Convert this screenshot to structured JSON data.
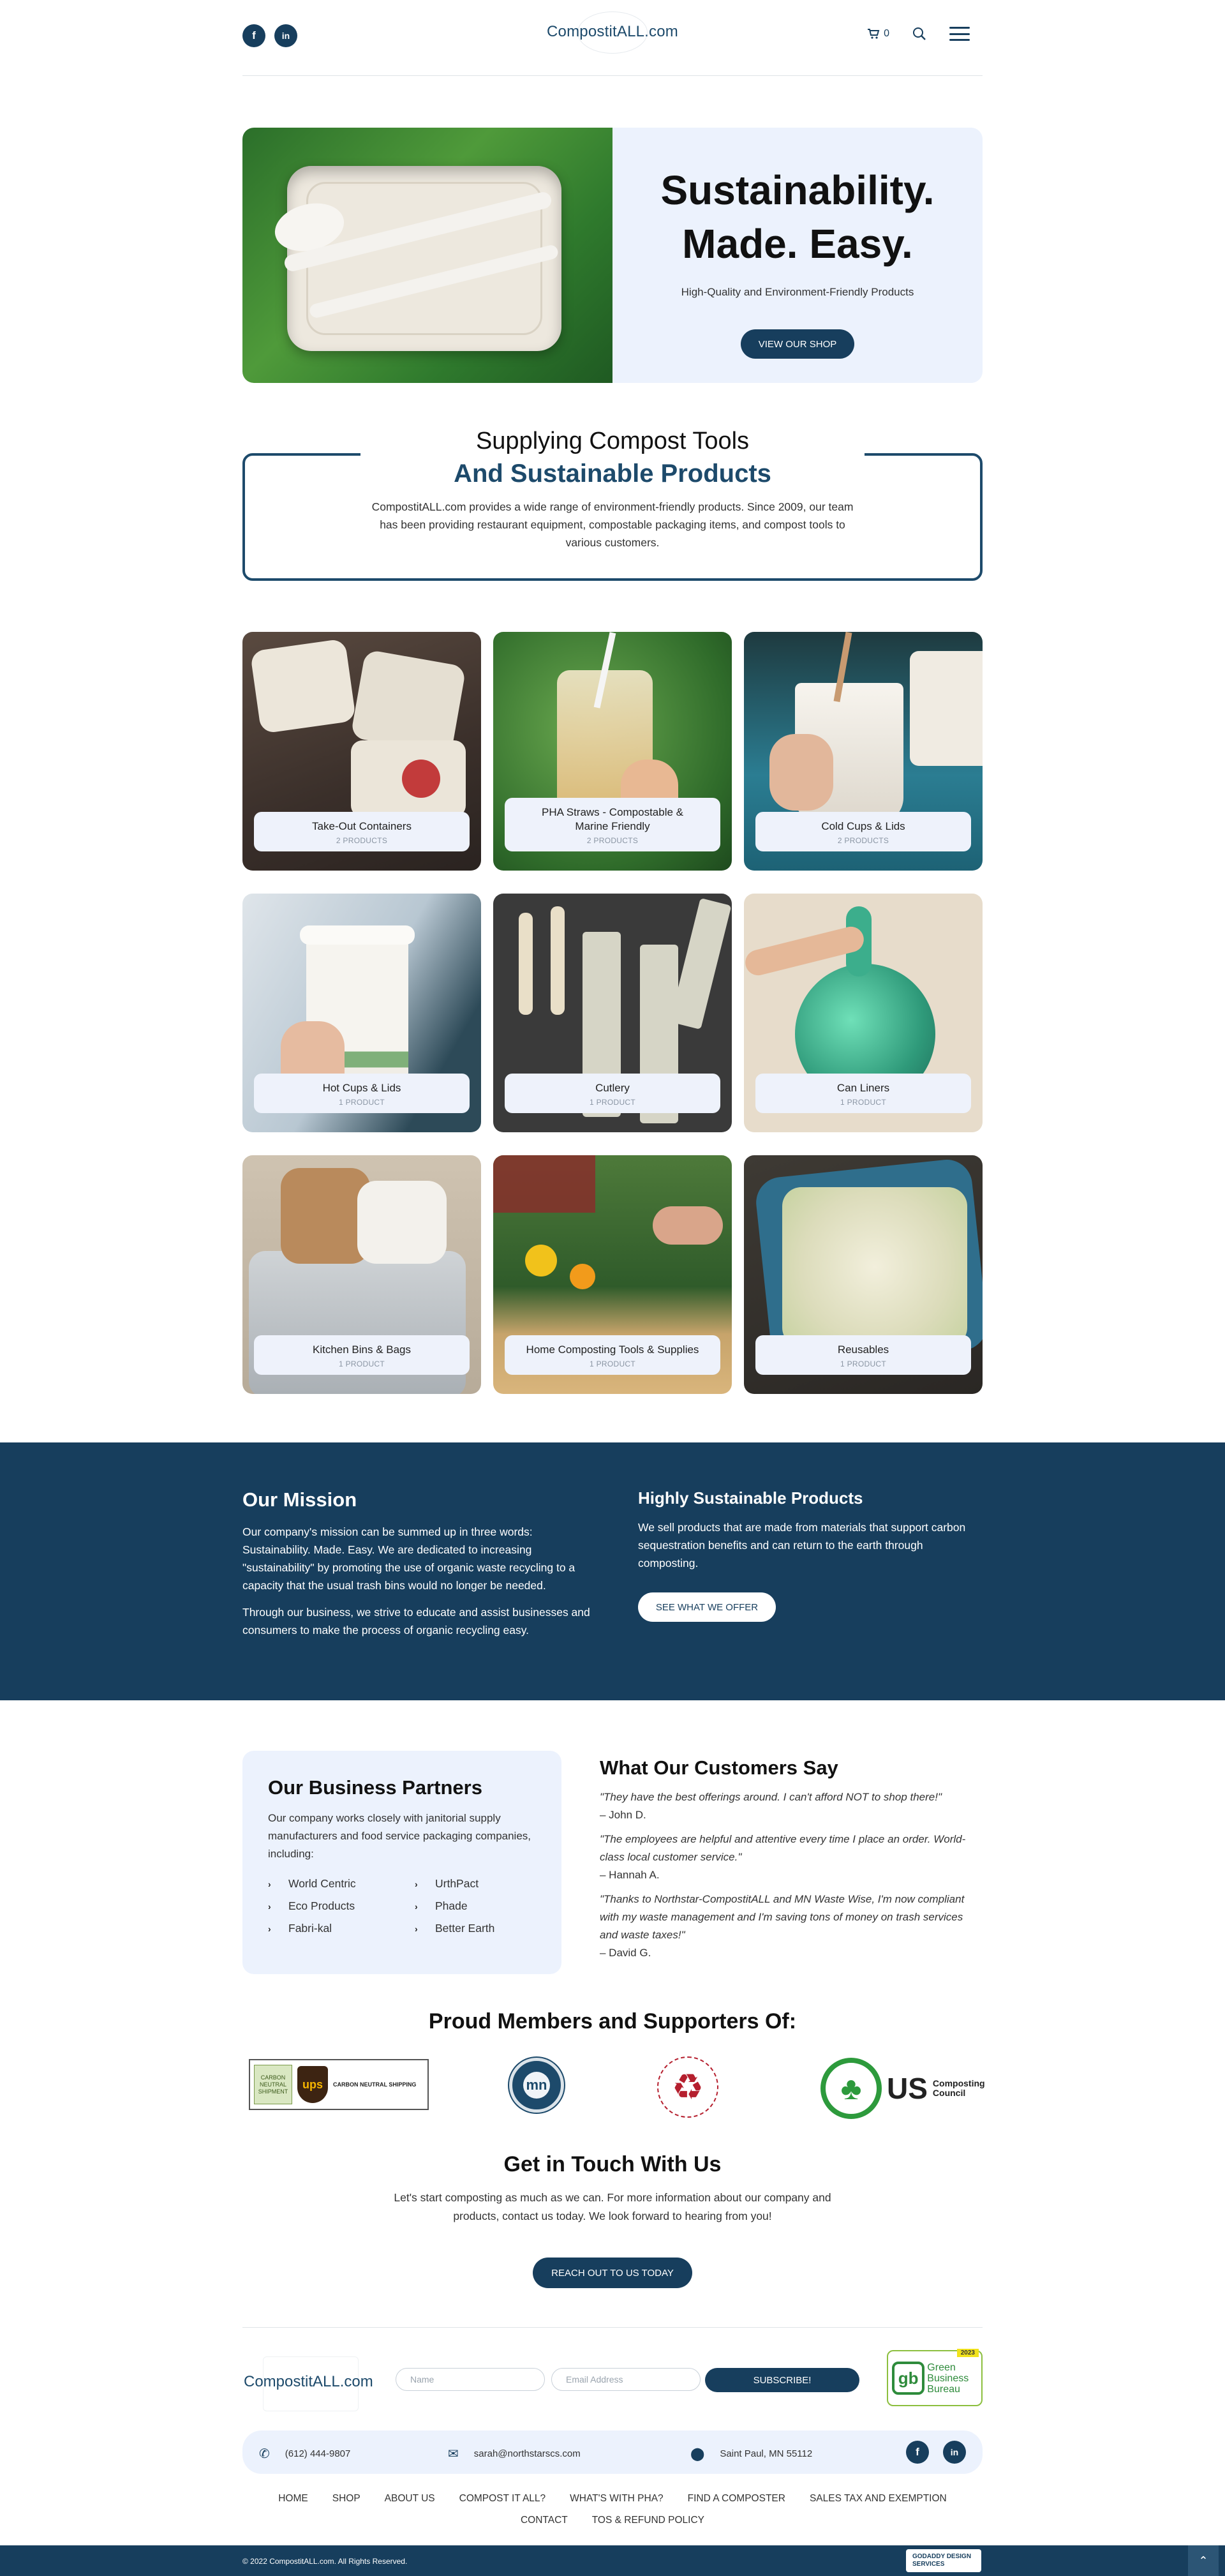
{
  "header": {
    "logo": "CompostitALL.com",
    "cart_count": "0",
    "social": {
      "facebook": "f",
      "linkedin": "in"
    }
  },
  "hero": {
    "title": "Sustainability. Made. Easy.",
    "subtitle": "High-Quality and Environment-Friendly Products",
    "button": "VIEW OUR SHOP"
  },
  "supply": {
    "title": "Supplying Compost Tools",
    "subtitle": "And Sustainable Products",
    "body": "CompostitALL.com provides a wide range of environment-friendly products. Since 2009, our team has been providing restaurant equipment, compostable packaging items, and compost tools to various customers."
  },
  "products": [
    {
      "name": "Take-Out Containers",
      "count": "2 PRODUCTS"
    },
    {
      "name": "PHA Straws - Compostable & Marine Friendly",
      "count": "2 PRODUCTS"
    },
    {
      "name": "Cold Cups & Lids",
      "count": "2 PRODUCTS"
    },
    {
      "name": "Hot Cups & Lids",
      "count": "1 PRODUCT"
    },
    {
      "name": "Cutlery",
      "count": "1 PRODUCT"
    },
    {
      "name": "Can Liners",
      "count": "1 PRODUCT"
    },
    {
      "name": "Kitchen Bins & Bags",
      "count": "1 PRODUCT"
    },
    {
      "name": "Home Composting Tools & Supplies",
      "count": "1 PRODUCT"
    },
    {
      "name": "Reusables",
      "count": "1 PRODUCT"
    }
  ],
  "mission": {
    "title": "Our Mission",
    "p1": "Our company's mission can be summed up in three words: Sustainability. Made. Easy. We are dedicated to increasing \"sustainability\" by promoting the use of organic waste recycling to a capacity that the usual trash bins would no longer be needed.",
    "p2": "Through our business, we strive to educate and assist businesses and consumers to make the process of organic recycling easy.",
    "products_title": "Highly Sustainable Products",
    "products_body": "We sell products that are made from materials that support carbon sequestration benefits and can return to the earth through composting.",
    "button": "SEE WHAT WE OFFER"
  },
  "partners": {
    "title": "Our Business Partners",
    "body": "Our company works closely with janitorial supply manufacturers and food service packaging companies, including:",
    "list": [
      "World Centric",
      "UrthPact",
      "Eco Products",
      "Phade",
      "Fabri-kal",
      "Better Earth"
    ]
  },
  "customers": {
    "title": "What Our Customers Say",
    "quotes": [
      {
        "text": "\"They have the best offerings around. I can't afford NOT to shop there!\"",
        "author": "– John D."
      },
      {
        "text": "\"The employees are helpful and attentive every time I place an order. World-class local customer service.\"",
        "author": "– Hannah A."
      },
      {
        "text": "\"Thanks to Northstar-CompostitALL and MN Waste Wise, I'm now compliant with my waste management and I'm saving tons of money on trash services and waste taxes!\"",
        "author": "– David G."
      }
    ]
  },
  "members": {
    "title": "Proud Members and Supporters Of:",
    "ups_badge": "CARBON NEUTRAL SHIPMENT",
    "ups_title": "CARBON NEUTRAL SHIPPING",
    "ups_logo": "ups",
    "mn_logo": "mn",
    "uscc_us": "US",
    "uscc_text": "Composting Council"
  },
  "contact": {
    "title": "Get in Touch With Us",
    "body": "Let's start composting as much as we can. For more information about our company and products, contact us today. We look forward to hearing from you!",
    "button": "REACH OUT TO US TODAY"
  },
  "footer": {
    "logo": "CompostitALL.com",
    "name_placeholder": "Name",
    "email_placeholder": "Email Address",
    "subscribe": "SUBSCRIBE!",
    "gbb_tag": "2023",
    "gbb_text": "Green Business Bureau",
    "phone": "(612) 444-9807",
    "email": "sarah@northstarscs.com",
    "location": "Saint Paul, MN 55112",
    "nav": [
      "HOME",
      "SHOP",
      "ABOUT US",
      "COMPOST IT ALL?",
      "WHAT'S WITH PHA?",
      "FIND A COMPOSTER",
      "SALES TAX AND EXEMPTION",
      "CONTACT",
      "TOS & REFUND POLICY"
    ],
    "copyright": "© 2022 CompostitALL.com. All Rights Reserved.",
    "designer": "GODADDY DESIGN SERVICES"
  },
  "colors": {
    "primary": "#173e5d",
    "accent_bg": "#ecf2fd"
  }
}
